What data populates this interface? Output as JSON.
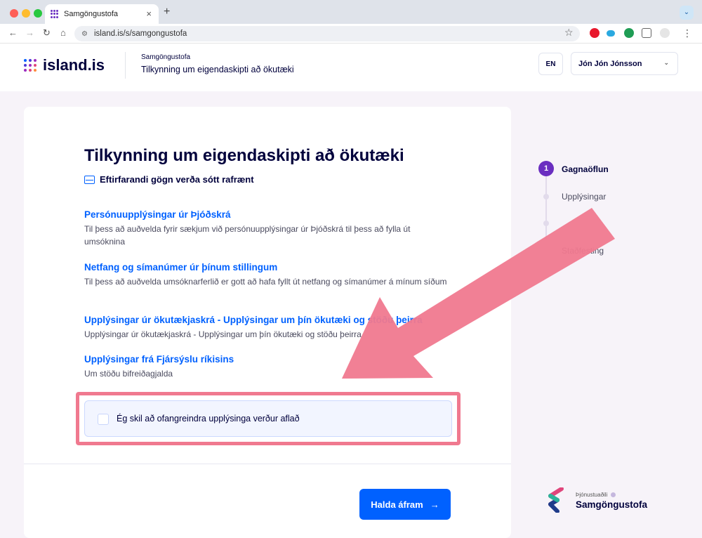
{
  "browser": {
    "tab_title": "Samgöngustofa",
    "tab_close": "×",
    "new_tab": "+",
    "url": "island.is/s/samgongustofa",
    "tab_menu": "⌄",
    "back": "←",
    "forward": "→",
    "reload": "↻",
    "home": "⌂",
    "star": "☆",
    "menu": "⋮"
  },
  "header": {
    "logo_text": "island.is",
    "institution": "Samgöngustofa",
    "application_title": "Tilkynning um eigendaskipti að ökutæki",
    "language_button": "EN",
    "user_name": "Jón Jón Jónsson",
    "user_chevron": "⌄"
  },
  "main": {
    "title": "Tilkynning um eigendaskipti að ökutæki",
    "subtitle": "Eftirfarandi gögn verða sótt rafrænt",
    "data_providers": [
      {
        "title": "Persónuupplýsingar úr Þjóðskrá",
        "description": "Til þess að auðvelda fyrir sækjum við persónuupplýsingar úr Þjóðskrá til þess að fylla út umsóknina"
      },
      {
        "title": "Netfang og símanúmer úr þínum stillingum",
        "description": "Til þess að auðvelda umsóknarferlið er gott að hafa fyllt út netfang og símanúmer á mínum síðum"
      },
      {
        "title": "Upplýsingar úr ökutækjaskrá - Upplýsingar um þín ökutæki og stöðu þeirra",
        "description": "Upplýsingar úr ökutækjaskrá - Upplýsingar um þín ökutæki og stöðu þeirra"
      },
      {
        "title": "Upplýsingar frá Fjársýslu ríkisins",
        "description": "Um stöðu bifreiðagjalda"
      }
    ],
    "consent_label": "Ég skil að ofangreindra upplýsinga verður aflað",
    "consent_checked": false,
    "continue_button": "Halda áfram",
    "continue_arrow": "→"
  },
  "stepper": {
    "active_step_number": "1",
    "steps": [
      "Gagnaöflun",
      "Upplýsingar",
      "",
      "Staðfesting"
    ]
  },
  "footer_institution": {
    "caption": "Þjónustuaðili",
    "name": "Samgöngustofa"
  },
  "colors": {
    "brand_blue": "#0061ff",
    "brand_purple": "#6a2ec0",
    "annotation_pink": "#f0798f"
  }
}
